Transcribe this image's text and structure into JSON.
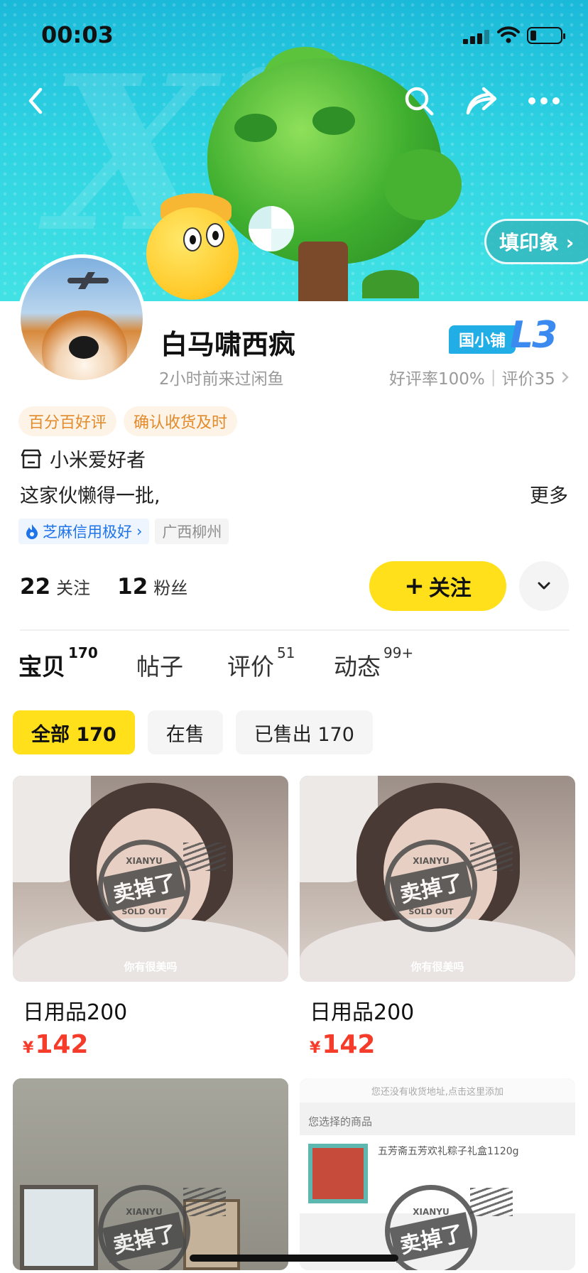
{
  "status_bar": {
    "time": "00:03"
  },
  "header": {
    "impression_button": "填印象 ›"
  },
  "profile": {
    "username": "白马啸西疯",
    "last_seen": "2小时前来过闲鱼",
    "shop_badge": "国小铺",
    "level": "L3",
    "rating_rate": "好评率100%",
    "rating_count": "评价35",
    "tags": [
      "百分百好评",
      "确认收货及时"
    ],
    "store_label": "小米爱好者",
    "bio": "这家伙懒得一批,",
    "more": "更多",
    "credit": "芝麻信用极好",
    "location": "广西柳州"
  },
  "stats": {
    "following_count": "22",
    "following_label": "关注",
    "followers_count": "12",
    "followers_label": "粉丝"
  },
  "actions": {
    "follow_label": "关注"
  },
  "tabs": [
    {
      "label": "宝贝",
      "count": "170"
    },
    {
      "label": "帖子",
      "count": ""
    },
    {
      "label": "评价",
      "count": "51"
    },
    {
      "label": "动态",
      "count": "99+"
    }
  ],
  "filters": [
    {
      "label": "全部 170"
    },
    {
      "label": "在售"
    },
    {
      "label": "已售出 170"
    }
  ],
  "products": [
    {
      "title": "日用品200",
      "currency": "¥",
      "price": "142",
      "stamp_top": "XIANYU",
      "stamp_main": "卖掉了",
      "stamp_bottom": "SOLD OUT",
      "caption": "你有很美吗"
    },
    {
      "title": "日用品200",
      "currency": "¥",
      "price": "142",
      "stamp_top": "XIANYU",
      "stamp_main": "卖掉了",
      "stamp_bottom": "SOLD OUT",
      "caption": "你有很美吗"
    },
    {
      "stamp_top": "XIANYU",
      "stamp_main": "卖掉了"
    },
    {
      "stamp_top": "XIANYU",
      "stamp_main": "卖掉了",
      "order_notice": "您还没有收货地址,点击这里添加",
      "order_heading": "您选择的商品",
      "order_item": "五芳斋五芳欢礼粽子礼盒1120g"
    }
  ],
  "colors": {
    "accent_yellow": "#ffe01b",
    "price_red": "#f53b2a",
    "banner_cyan": "#2ed3e2",
    "level_blue": "#3b8af0"
  }
}
